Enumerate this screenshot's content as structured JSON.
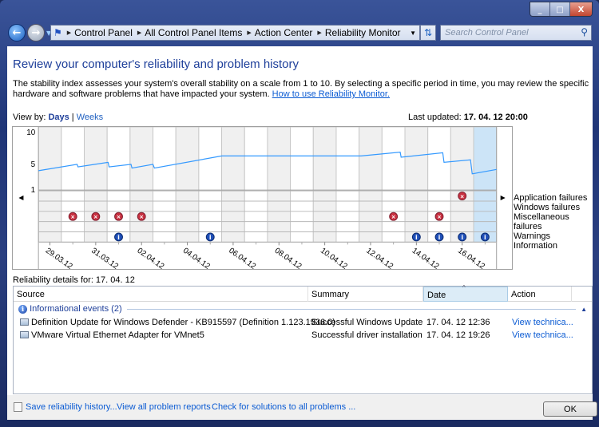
{
  "window": {
    "minimize": "_",
    "maximize": "□",
    "close": "X"
  },
  "address": {
    "crumbs": [
      "Control Panel",
      "All Control Panel Items",
      "Action Center",
      "Reliability Monitor"
    ],
    "search_placeholder": "Search Control Panel"
  },
  "page": {
    "title": "Review your computer's reliability and problem history",
    "description": "The stability index assesses your system's overall stability on a scale from 1 to 10. By selecting a specific period in time, you may review the specific hardware and software problems that have impacted your system.",
    "help_link": "How to use Reliability Monitor.",
    "view_by_label": "View by:",
    "view_days": "Days",
    "view_sep": "|",
    "view_weeks": "Weeks",
    "last_updated_label": "Last updated:",
    "last_updated_value": "17. 04. 12 20:00"
  },
  "chart_data": {
    "type": "line",
    "ylim": [
      1,
      10
    ],
    "y_ticks": [
      10,
      5,
      1
    ],
    "days": [
      "29.03.12",
      "30.03.12",
      "31.03.12",
      "01.04.12",
      "02.04.12",
      "03.04.12",
      "04.04.12",
      "05.04.12",
      "06.04.12",
      "07.04.12",
      "08.04.12",
      "09.04.12",
      "10.04.12",
      "11.04.12",
      "12.04.12",
      "13.04.12",
      "14.04.12",
      "15.04.12",
      "16.04.12",
      "17.04.12"
    ],
    "x_tick_labels": [
      "29.03.12",
      "31.03.12",
      "02.04.12",
      "04.04.12",
      "06.04.12",
      "08.04.12",
      "10.04.12",
      "12.04.12",
      "14.04.12",
      "16.04.12"
    ],
    "selected_day": "17.04.12",
    "stability_index": [
      [
        "29.03.12 00:00",
        3.9
      ],
      [
        "30.03.12 16:30",
        4.9
      ],
      [
        "30.03.12 17:30",
        4.5
      ],
      [
        "01.04.12 01:00",
        5.2
      ],
      [
        "01.04.12 02:00",
        4.5
      ],
      [
        "02.04.12 01:00",
        4.9
      ],
      [
        "02.04.12 02:00",
        4.3
      ],
      [
        "03.04.12 00:00",
        4.9
      ],
      [
        "03.04.12 01:30",
        4.3
      ],
      [
        "06.04.12 00:00",
        6.2
      ],
      [
        "12.04.12 02:00",
        6.2
      ],
      [
        "13.04.12 19:00",
        6.8
      ],
      [
        "13.04.12 20:00",
        6.0
      ],
      [
        "15.04.12 15:40",
        6.7
      ],
      [
        "15.04.12 17:00",
        5.2
      ],
      [
        "16.04.12 20:40",
        5.6
      ],
      [
        "16.04.12 22:30",
        3.4
      ],
      [
        "17.04.12 23:59",
        4.1
      ]
    ],
    "line_color": "#3399ff",
    "event_rows": [
      "Application failures",
      "Windows failures",
      "Miscellaneous failures",
      "Warnings",
      "Information"
    ],
    "events": {
      "Application failures": [
        "16.04.12"
      ],
      "Windows failures": [],
      "Miscellaneous failures": [
        "30.03.12",
        "31.03.12",
        "01.04.12",
        "02.04.12",
        "13.04.12",
        "15.04.12"
      ],
      "Warnings": [],
      "Information": [
        "01.04.12",
        "05.04.12",
        "14.04.12",
        "15.04.12",
        "16.04.12",
        "17.04.12"
      ]
    }
  },
  "details": {
    "label": "Reliability details for: 17. 04. 12",
    "columns": [
      "Source",
      "Summary",
      "Date",
      "Action"
    ],
    "group": "Informational events (2)",
    "rows": [
      {
        "source": "Definition Update for Windows Defender - KB915597 (Definition 1.123.1936.0)",
        "summary": "Successful Windows Update",
        "date": "17. 04. 12 12:36",
        "action": "View technica..."
      },
      {
        "source": "VMware Virtual Ethernet Adapter for VMnet5",
        "summary": "Successful driver installation",
        "date": "17. 04. 12 19:26",
        "action": "View technica..."
      }
    ]
  },
  "footer": {
    "save": "Save reliability history...",
    "view_all": "View all problem reports",
    "check": "Check for solutions to all problems ...",
    "ok": "OK"
  }
}
